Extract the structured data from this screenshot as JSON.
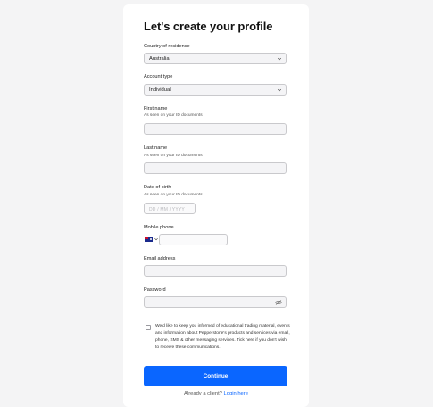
{
  "title": "Let's create your profile",
  "country": {
    "label": "Country of residence",
    "value": "Australia"
  },
  "account_type": {
    "label": "Account type",
    "value": "Individual"
  },
  "first_name": {
    "label": "First name",
    "hint": "As seen on your ID documents",
    "value": ""
  },
  "last_name": {
    "label": "Last name",
    "hint": "As seen on your ID documents",
    "value": ""
  },
  "dob": {
    "label": "Date of birth",
    "hint": "As seen on your ID documents",
    "placeholder": "DD / MM / YYYY"
  },
  "mobile": {
    "label": "Mobile phone",
    "flag_icon": "australia-flag-icon",
    "value": ""
  },
  "email": {
    "label": "Email address",
    "value": ""
  },
  "password": {
    "label": "Password",
    "value": "",
    "toggle_icon": "eye-off-icon"
  },
  "consent": {
    "checked": false,
    "text": "We'd like to keep you informed of educational trading material, events and information about Pepperstone's products and services via email, phone, SMS & other messaging services. Tick here if you don't wish to receive these communications."
  },
  "continue_label": "Continue",
  "login_prompt": "Already a client?",
  "login_link": "Login here",
  "colors": {
    "primary": "#0a66ff",
    "background": "#f4f4f5",
    "card": "#ffffff"
  }
}
